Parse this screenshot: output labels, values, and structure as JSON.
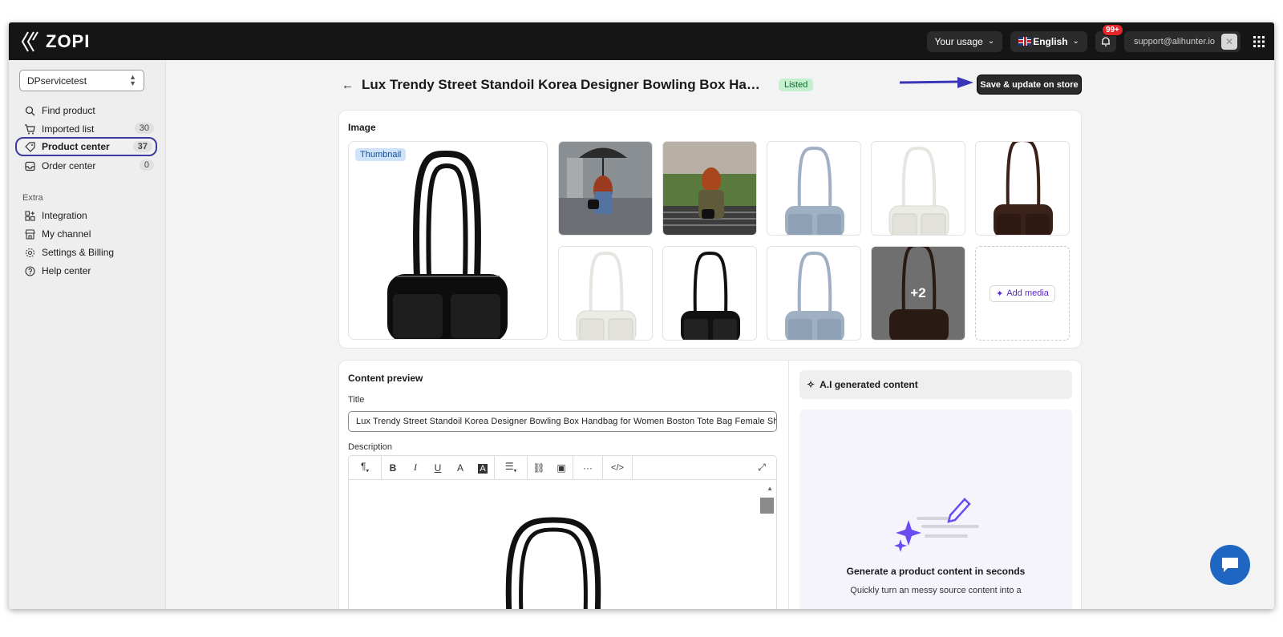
{
  "brand": {
    "name": "ZOPI"
  },
  "topbar": {
    "usage_label": "Your usage",
    "language_label": "English",
    "notif_badge": "99+",
    "user_email": "support@alihunter.io"
  },
  "sidebar": {
    "store": "DPservicetest",
    "items": [
      {
        "label": "Find product",
        "count": ""
      },
      {
        "label": "Imported list",
        "count": "30"
      },
      {
        "label": "Product center",
        "count": "37"
      },
      {
        "label": "Order center",
        "count": "0"
      }
    ],
    "extra_label": "Extra",
    "extra_items": [
      {
        "label": "Integration"
      },
      {
        "label": "My channel"
      },
      {
        "label": "Settings & Billing"
      },
      {
        "label": "Help center"
      }
    ]
  },
  "product": {
    "title": "Lux Trendy Street Standoil Korea Designer Bowling Box Handbag for Women Boston Tote Bag  Female Shoulder Bag",
    "status": "Listed",
    "save_label": "Save & update on store"
  },
  "image_section": {
    "title": "Image",
    "thumbnail_label": "Thumbnail",
    "more_label": "+2",
    "add_media_label": "Add media"
  },
  "content": {
    "title": "Content preview",
    "title_label": "Title",
    "title_value": "Lux Trendy Street Standoil Korea Designer Bowling Box Handbag for Women Boston Tote Bag  Female Shoulder Bag",
    "description_label": "Description"
  },
  "ai": {
    "header": "A.I generated content",
    "heading": "Generate a product content in seconds",
    "text": "Quickly turn an messy source content into a"
  },
  "colors": {
    "accent": "#3d3aa0",
    "listed_bg": "#c5f0cf",
    "listed_fg": "#0c6b2a",
    "ai_purple": "#6b4cf0"
  }
}
